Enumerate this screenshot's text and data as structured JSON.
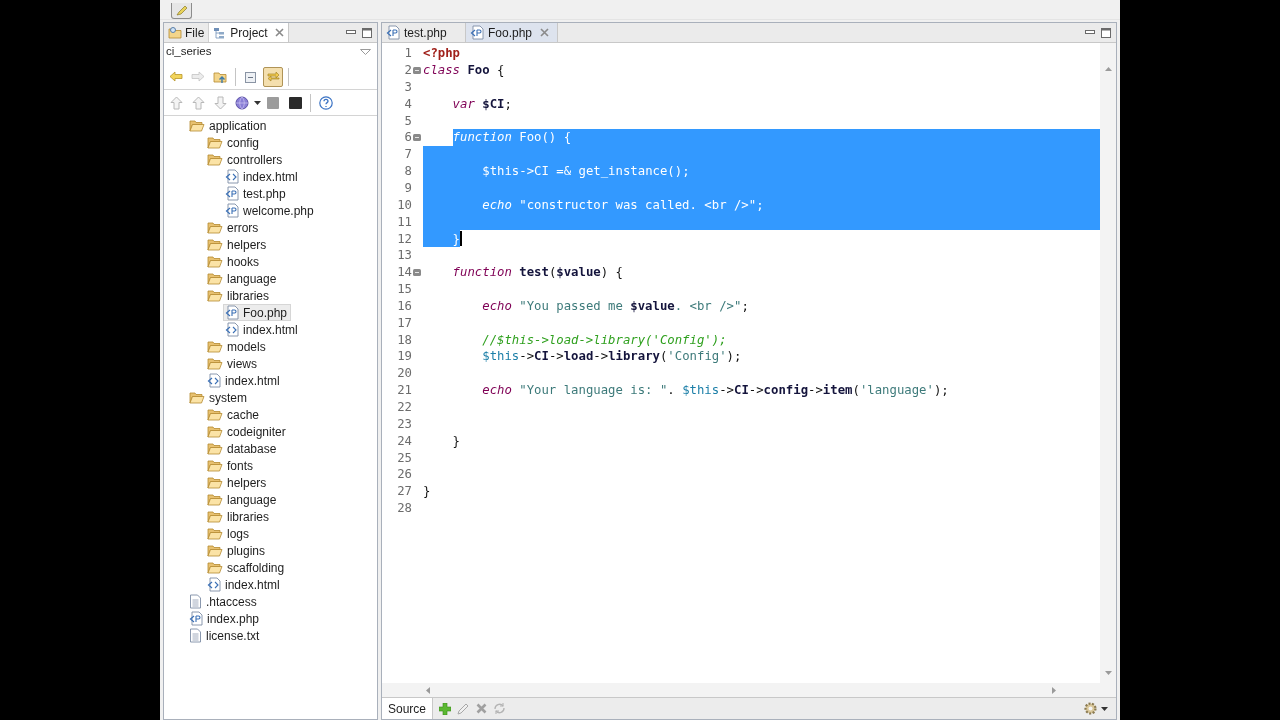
{
  "left_panel": {
    "tabs": [
      {
        "label": "File",
        "kind": "file",
        "selected": false
      },
      {
        "label": "Project",
        "kind": "project",
        "selected": true
      }
    ],
    "project": "ci_series",
    "link_with_editor_pressed": true,
    "tree": [
      {
        "label": "application",
        "kind": "folder",
        "selected": false,
        "children": [
          {
            "label": "config",
            "kind": "folder",
            "selected": false
          },
          {
            "label": "controllers",
            "kind": "folder",
            "selected": false,
            "children": [
              {
                "label": "index.html",
                "kind": "html",
                "selected": false
              },
              {
                "label": "test.php",
                "kind": "php",
                "selected": false
              },
              {
                "label": "welcome.php",
                "kind": "php",
                "selected": false
              }
            ]
          },
          {
            "label": "errors",
            "kind": "folder",
            "selected": false
          },
          {
            "label": "helpers",
            "kind": "folder",
            "selected": false
          },
          {
            "label": "hooks",
            "kind": "folder",
            "selected": false
          },
          {
            "label": "language",
            "kind": "folder",
            "selected": false
          },
          {
            "label": "libraries",
            "kind": "folder",
            "selected": false,
            "children": [
              {
                "label": "Foo.php",
                "kind": "php",
                "selected": true
              },
              {
                "label": "index.html",
                "kind": "html",
                "selected": false
              }
            ]
          },
          {
            "label": "models",
            "kind": "folder",
            "selected": false
          },
          {
            "label": "views",
            "kind": "folder",
            "selected": false
          },
          {
            "label": "index.html",
            "kind": "html",
            "selected": false
          }
        ]
      },
      {
        "label": "system",
        "kind": "folder",
        "selected": false,
        "children": [
          {
            "label": "cache",
            "kind": "folder",
            "selected": false
          },
          {
            "label": "codeigniter",
            "kind": "folder",
            "selected": false
          },
          {
            "label": "database",
            "kind": "folder",
            "selected": false
          },
          {
            "label": "fonts",
            "kind": "folder",
            "selected": false
          },
          {
            "label": "helpers",
            "kind": "folder",
            "selected": false
          },
          {
            "label": "language",
            "kind": "folder",
            "selected": false
          },
          {
            "label": "libraries",
            "kind": "folder",
            "selected": false
          },
          {
            "label": "logs",
            "kind": "folder",
            "selected": false
          },
          {
            "label": "plugins",
            "kind": "folder",
            "selected": false
          },
          {
            "label": "scaffolding",
            "kind": "folder",
            "selected": false
          },
          {
            "label": "index.html",
            "kind": "html",
            "selected": false
          }
        ]
      },
      {
        "label": ".htaccess",
        "kind": "text",
        "selected": false
      },
      {
        "label": "index.php",
        "kind": "php",
        "selected": false
      },
      {
        "label": "license.txt",
        "kind": "text",
        "selected": false
      }
    ]
  },
  "editor": {
    "tabs": [
      {
        "label": "test.php",
        "selected": false
      },
      {
        "label": "Foo.php",
        "selected": true
      }
    ],
    "lines": [
      {
        "number": "1",
        "fold": false,
        "selected": false,
        "caret": false,
        "tokens": [
          {
            "kind": "tag",
            "text": "<?php"
          }
        ]
      },
      {
        "number": "2",
        "fold": true,
        "selected": false,
        "caret": false,
        "tokens": [
          {
            "kind": "keyword",
            "text": "class "
          },
          {
            "kind": "name",
            "text": "Foo"
          },
          {
            "kind": "plain",
            "text": " {"
          }
        ]
      },
      {
        "number": "3",
        "fold": false,
        "selected": false,
        "caret": false
      },
      {
        "number": "4",
        "fold": false,
        "selected": false,
        "caret": false,
        "tokens": [
          {
            "kind": "keyword",
            "text": "    var "
          },
          {
            "kind": "name",
            "text": "$CI"
          },
          {
            "kind": "plain",
            "text": ";"
          }
        ]
      },
      {
        "number": "5",
        "fold": false,
        "selected": false,
        "caret": false
      },
      {
        "number": "6",
        "fold": true,
        "selected": true,
        "caret": false,
        "tokens": [
          {
            "kind": "keyword",
            "text": "    function "
          },
          {
            "kind": "name",
            "text": "Foo"
          },
          {
            "kind": "plain",
            "text": "() {"
          }
        ]
      },
      {
        "number": "7",
        "fold": false,
        "selected": true,
        "caret": false
      },
      {
        "number": "8",
        "fold": false,
        "selected": true,
        "caret": false,
        "tokens": [
          {
            "kind": "this",
            "text": "        $this"
          },
          {
            "kind": "plain",
            "text": "->"
          },
          {
            "kind": "name",
            "text": "CI"
          },
          {
            "kind": "plain",
            "text": " =& "
          },
          {
            "kind": "name",
            "text": "get_instance"
          },
          {
            "kind": "plain",
            "text": "();"
          }
        ]
      },
      {
        "number": "9",
        "fold": false,
        "selected": true,
        "caret": false
      },
      {
        "number": "10",
        "fold": false,
        "selected": true,
        "caret": false,
        "tokens": [
          {
            "kind": "keyword",
            "text": "        echo "
          },
          {
            "kind": "string",
            "text": "\"constructor was called. <br />\""
          },
          {
            "kind": "plain",
            "text": ";"
          }
        ]
      },
      {
        "number": "11",
        "fold": false,
        "selected": true,
        "caret": false
      },
      {
        "number": "12",
        "fold": false,
        "selected": true,
        "caret": true,
        "tokens": [
          {
            "kind": "plain",
            "text": "    }"
          }
        ]
      },
      {
        "number": "13",
        "fold": false,
        "selected": false,
        "caret": false
      },
      {
        "number": "14",
        "fold": true,
        "selected": false,
        "caret": false,
        "tokens": [
          {
            "kind": "keyword",
            "text": "    function "
          },
          {
            "kind": "name",
            "text": "test"
          },
          {
            "kind": "plain",
            "text": "("
          },
          {
            "kind": "name",
            "text": "$value"
          },
          {
            "kind": "plain",
            "text": ") {"
          }
        ]
      },
      {
        "number": "15",
        "fold": false,
        "selected": false,
        "caret": false
      },
      {
        "number": "16",
        "fold": false,
        "selected": false,
        "caret": false,
        "tokens": [
          {
            "kind": "keyword",
            "text": "        echo "
          },
          {
            "kind": "string",
            "text": "\"You passed me "
          },
          {
            "kind": "name",
            "text": "$value"
          },
          {
            "kind": "string",
            "text": ". <br />\""
          },
          {
            "kind": "plain",
            "text": ";"
          }
        ]
      },
      {
        "number": "17",
        "fold": false,
        "selected": false,
        "caret": false
      },
      {
        "number": "18",
        "fold": false,
        "selected": false,
        "caret": false,
        "tokens": [
          {
            "kind": "comment",
            "text": "        //$this->load->library('Config');"
          }
        ]
      },
      {
        "number": "19",
        "fold": false,
        "selected": false,
        "caret": false,
        "tokens": [
          {
            "kind": "this",
            "text": "        $this"
          },
          {
            "kind": "plain",
            "text": "->"
          },
          {
            "kind": "name",
            "text": "CI"
          },
          {
            "kind": "plain",
            "text": "->"
          },
          {
            "kind": "name",
            "text": "load"
          },
          {
            "kind": "plain",
            "text": "->"
          },
          {
            "kind": "name",
            "text": "library"
          },
          {
            "kind": "plain",
            "text": "("
          },
          {
            "kind": "string",
            "text": "'Config'"
          },
          {
            "kind": "plain",
            "text": ");"
          }
        ]
      },
      {
        "number": "20",
        "fold": false,
        "selected": false,
        "caret": false
      },
      {
        "number": "21",
        "fold": false,
        "selected": false,
        "caret": false,
        "tokens": [
          {
            "kind": "keyword",
            "text": "        echo "
          },
          {
            "kind": "string",
            "text": "\"Your language is: \""
          },
          {
            "kind": "plain",
            "text": ". "
          },
          {
            "kind": "this",
            "text": "$this"
          },
          {
            "kind": "plain",
            "text": "->"
          },
          {
            "kind": "name",
            "text": "CI"
          },
          {
            "kind": "plain",
            "text": "->"
          },
          {
            "kind": "name",
            "text": "config"
          },
          {
            "kind": "plain",
            "text": "->"
          },
          {
            "kind": "name",
            "text": "item"
          },
          {
            "kind": "plain",
            "text": "("
          },
          {
            "kind": "string",
            "text": "'language'"
          },
          {
            "kind": "plain",
            "text": ");"
          }
        ]
      },
      {
        "number": "22",
        "fold": false,
        "selected": false,
        "caret": false
      },
      {
        "number": "23",
        "fold": false,
        "selected": false,
        "caret": false
      },
      {
        "number": "24",
        "fold": false,
        "selected": false,
        "caret": false,
        "tokens": [
          {
            "kind": "plain",
            "text": "    }"
          }
        ]
      },
      {
        "number": "25",
        "fold": false,
        "selected": false,
        "caret": false
      },
      {
        "number": "26",
        "fold": false,
        "selected": false,
        "caret": false
      },
      {
        "number": "27",
        "fold": false,
        "selected": false,
        "caret": false,
        "tokens": [
          {
            "kind": "plain",
            "text": "}"
          }
        ]
      },
      {
        "number": "28",
        "fold": false,
        "selected": false,
        "caret": false
      }
    ],
    "bottom_tabs": [
      {
        "label": "Source",
        "selected": true
      }
    ]
  }
}
